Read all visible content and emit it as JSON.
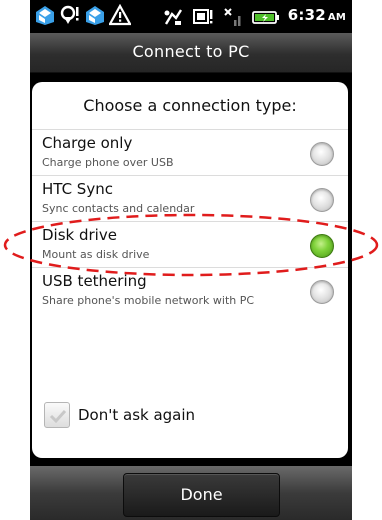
{
  "status_bar": {
    "time": "6:32",
    "ampm": "AM",
    "left_icons": [
      "htc-sync-icon",
      "location-alert-icon",
      "htc-sync-icon",
      "warning-icon"
    ],
    "right_icons": [
      "usb-debug-icon",
      "screen-alert-icon",
      "no-signal-icon",
      "battery-charging-icon"
    ]
  },
  "title_bar": {
    "title": "Connect to PC"
  },
  "dialog": {
    "header": "Choose a connection type:",
    "options": [
      {
        "label": "Charge only",
        "sublabel": "Charge phone over USB",
        "selected": false
      },
      {
        "label": "HTC Sync",
        "sublabel": "Sync contacts and calendar",
        "selected": false
      },
      {
        "label": "Disk drive",
        "sublabel": "Mount as disk drive",
        "selected": true
      },
      {
        "label": "USB tethering",
        "sublabel": "Share phone's mobile network with PC",
        "selected": false
      }
    ],
    "dont_ask": {
      "label": "Don't ask again",
      "checked": true
    }
  },
  "footer": {
    "done_label": "Done"
  },
  "colors": {
    "highlight": "#e01c1c",
    "radio_selected": "#7fd23a",
    "title_bar": "#3a3a3a"
  }
}
